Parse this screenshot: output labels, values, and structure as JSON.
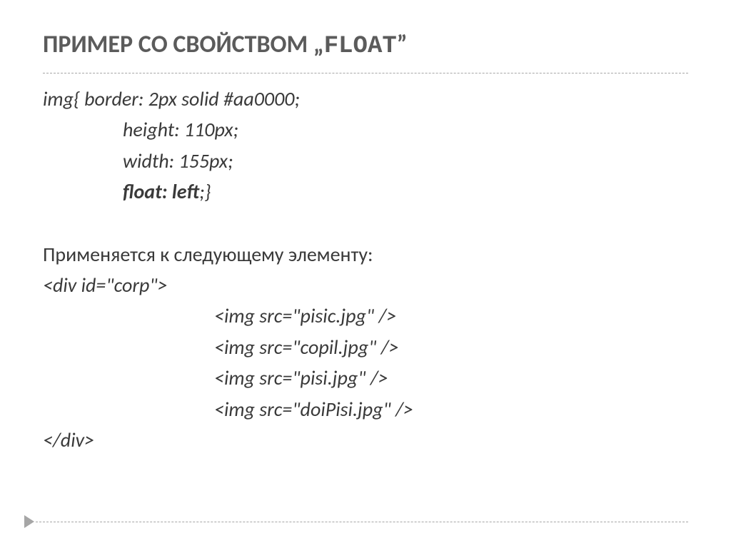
{
  "title": {
    "prefix": "ПРИМЕР СО СВОЙСТВОМ  „",
    "code": "FLOAT",
    "suffix": "”"
  },
  "css_block": {
    "line1_a": "img{ ",
    "line1_b": "border: 2px solid #aa0000;",
    "line2": "height: 110px;",
    "line3": "width: 155px;",
    "line4_a": "float: left",
    "line4_b": ";}"
  },
  "applies_text": "Применяется к следующему элементу:",
  "html_block": {
    "open": "<div id=\"corp\">",
    "img1": "<img src=\"pisic.jpg\" />",
    "img2": "<img src=\"copil.jpg\" />",
    "img3": "<img src=\"pisi.jpg\" />",
    "img4": "<img src=\"doiPisi.jpg\" />",
    "close": "</div>"
  }
}
